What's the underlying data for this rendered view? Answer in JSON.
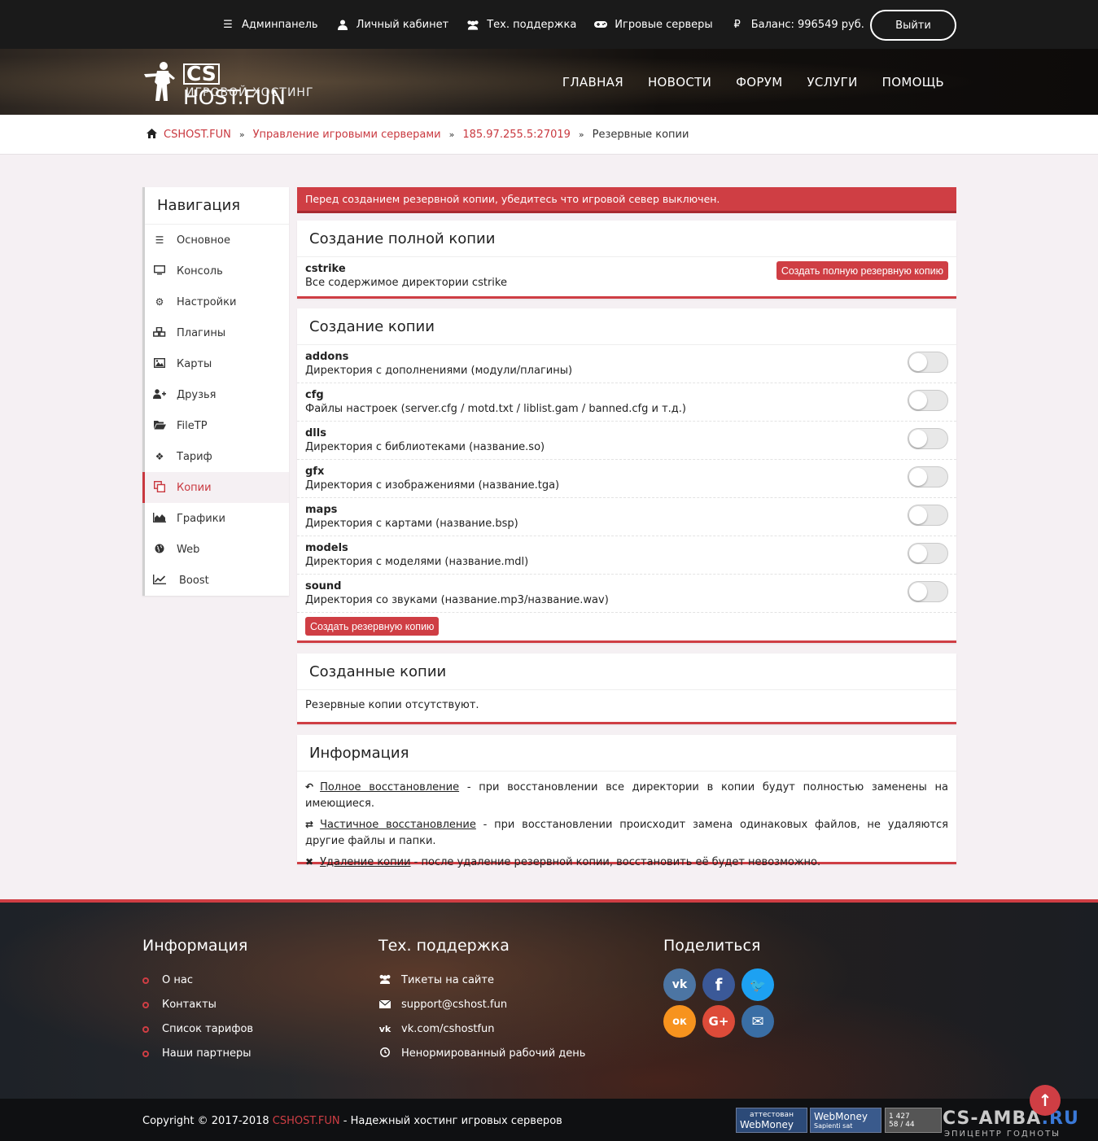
{
  "topbar": {
    "links": [
      {
        "label": "Админпанель",
        "icon": "list-icon"
      },
      {
        "label": "Личный кабинет",
        "icon": "user-icon"
      },
      {
        "label": "Тех. поддержка",
        "icon": "users-icon"
      },
      {
        "label": "Игровые серверы",
        "icon": "gamepad-icon"
      },
      {
        "label": "Баланс: 996549 руб.",
        "icon": "ruble-icon"
      }
    ],
    "logout_label": "Выйти"
  },
  "header": {
    "logo_cs": "CS",
    "logo_main": "HOST.FUN",
    "logo_sub": "ИГРОВОЙ ХОСТИНГ",
    "nav": [
      "ГЛАВНАЯ",
      "НОВОСТИ",
      "ФОРУМ",
      "УСЛУГИ",
      "ПОМОЩЬ"
    ]
  },
  "breadcrumb": {
    "items": [
      "CSHOST.FUN",
      "Управление игровыми серверами",
      "185.97.255.5:27019"
    ],
    "current": "Резервные копии"
  },
  "sidebar": {
    "title": "Навигация",
    "items": [
      {
        "label": "Основное",
        "icon": "bars-icon"
      },
      {
        "label": "Консоль",
        "icon": "desktop-icon"
      },
      {
        "label": "Настройки",
        "icon": "gear-icon"
      },
      {
        "label": "Плагины",
        "icon": "cubes-icon"
      },
      {
        "label": "Карты",
        "icon": "image-icon"
      },
      {
        "label": "Друзья",
        "icon": "user-plus-icon"
      },
      {
        "label": "FileTP",
        "icon": "folder-open-icon"
      },
      {
        "label": "Тариф",
        "icon": "dropbox-icon"
      },
      {
        "label": "Копии",
        "icon": "copy-icon"
      },
      {
        "label": "Графики",
        "icon": "area-chart-icon"
      },
      {
        "label": "Web",
        "icon": "globe-icon"
      },
      {
        "label": "Boost",
        "icon": "line-chart-icon"
      }
    ],
    "active": "Копии"
  },
  "alert": "Перед созданием резервной копии, убедитесь что игровой север выключен.",
  "full_copy": {
    "title": "Создание полной копии",
    "name": "cstrike",
    "desc": "Все содержимое директории cstrike",
    "button": "Создать полную резервную копию"
  },
  "copy": {
    "title": "Создание копии",
    "items": [
      {
        "name": "addons",
        "desc": "Директория с дополнениями (модули/плагины)",
        "enabled": false
      },
      {
        "name": "cfg",
        "desc": "Файлы настроек (server.cfg / motd.txt / liblist.gam / banned.cfg и т.д.)",
        "enabled": false
      },
      {
        "name": "dlls",
        "desc": "Директория с библиотеками (название.so)",
        "enabled": false
      },
      {
        "name": "gfx",
        "desc": "Директория с изображениями (название.tga)",
        "enabled": false
      },
      {
        "name": "maps",
        "desc": "Директория с картами (название.bsp)",
        "enabled": false
      },
      {
        "name": "models",
        "desc": "Директория с моделями (название.mdl)",
        "enabled": false
      },
      {
        "name": "sound",
        "desc": "Директория со звуками (название.mp3/название.wav)",
        "enabled": false
      }
    ],
    "button": "Создать резервную копию"
  },
  "created": {
    "title": "Созданные копии",
    "empty": "Резервные копии отсутствуют."
  },
  "info": {
    "title": "Информация",
    "lines": [
      {
        "icon": "reply-icon",
        "term": "Полное восстановление",
        "text": " - при восстановлении все директории в копии будут полностью заменены на имеющиеся."
      },
      {
        "icon": "retweet-icon",
        "term": "Частичное восстановление",
        "text": " - при восстановлении происходит замена одинаковых файлов, не удаляются другие файлы и папки."
      },
      {
        "icon": "times-icon",
        "term": "Удаление копии",
        "text": " - после удаление резервной копии, восстановить её будет невозможно."
      }
    ]
  },
  "footer": {
    "col1": {
      "title": "Информация",
      "items": [
        "О нас",
        "Контакты",
        "Список тарифов",
        "Наши партнеры"
      ]
    },
    "col2": {
      "title": "Тех. поддержка",
      "items": [
        {
          "label": "Тикеты на сайте",
          "icon": "users-icon"
        },
        {
          "label": "support@cshost.fun",
          "icon": "envelope-icon"
        },
        {
          "label": "vk.com/cshostfun",
          "icon": "vk-icon"
        },
        {
          "label": "Ненормированный рабочий день",
          "icon": "clock-icon"
        }
      ]
    },
    "col3": {
      "title": "Поделиться"
    },
    "social": [
      {
        "name": "vk-icon",
        "glyph": "vk",
        "color": "#4c75a3"
      },
      {
        "name": "facebook-icon",
        "glyph": "f",
        "color": "#3b5998"
      },
      {
        "name": "twitter-icon",
        "glyph": "🐦",
        "color": "#1da1f2"
      },
      {
        "name": "odnoklassniki-icon",
        "glyph": "ок",
        "color": "#f7931e"
      },
      {
        "name": "google-plus-icon",
        "glyph": "G+",
        "color": "#dd4b39"
      },
      {
        "name": "email-icon",
        "glyph": "✉",
        "color": "#3a6ea5"
      }
    ],
    "copyright_pre": "Copyright © 2017-2018 ",
    "copyright_brand": "CSHOST.FUN",
    "copyright_post": " - Надежный хостинг игровых серверов",
    "badges": [
      {
        "line1": "аттестован",
        "line2": "WebMoney"
      },
      {
        "line1": "WebMoney",
        "line2": "Sapienti sat"
      },
      {
        "line1": "1 427",
        "line2": "58 / 44"
      }
    ],
    "watermark_grey": "CS-AMBA",
    "watermark_blue": ".RU",
    "watermark_sub": "ЭПИЦЕНТР ГОДНОТЫ"
  },
  "colors": {
    "accent": "#cf3e44",
    "topbar": "#1a1a1a",
    "page": "#f5f0f3"
  }
}
